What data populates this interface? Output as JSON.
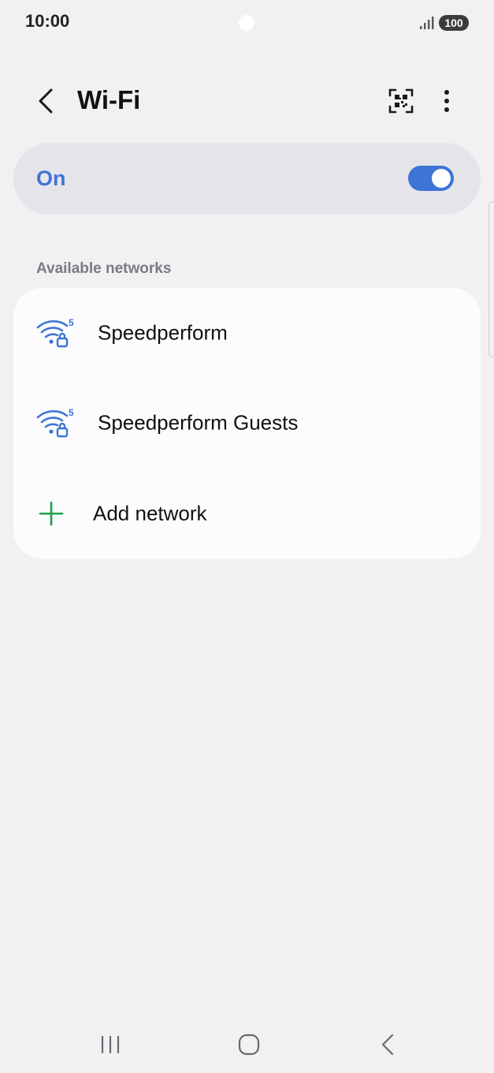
{
  "status_bar": {
    "time": "10:00",
    "battery": "100"
  },
  "header": {
    "title": "Wi-Fi"
  },
  "master_toggle": {
    "label": "On",
    "state": "on",
    "accent_color": "#3e74d6"
  },
  "available_networks": {
    "section_title": "Available networks",
    "networks": [
      {
        "name": "Speedperform",
        "band_badge": "5",
        "secured": true
      },
      {
        "name": "Speedperform Guests",
        "band_badge": "5",
        "secured": true
      }
    ],
    "add_network_label": "Add network"
  },
  "colors": {
    "background": "#f1f1f3",
    "card": "#fcfcfe",
    "wifi_icon": "#3e74d6",
    "add_icon": "#1fa14a"
  },
  "icons": {
    "back": "chevron-left-icon",
    "qr": "qr-scan-icon",
    "more": "more-vertical-icon",
    "wifi": "wifi-5ghz-lock-icon",
    "add": "plus-icon",
    "nav_recents": "recents-icon",
    "nav_home": "home-icon",
    "nav_back": "back-icon"
  }
}
